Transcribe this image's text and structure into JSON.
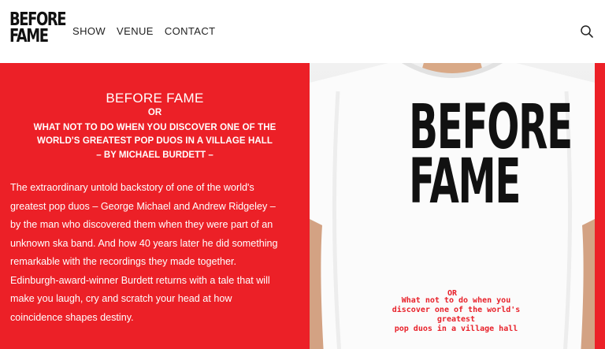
{
  "header": {
    "logo": [
      "BEFORE",
      "FAME"
    ],
    "nav": [
      "SHOW",
      "VENUE",
      "CONTACT"
    ],
    "search_icon": "search-icon"
  },
  "hero": {
    "background_color": "#ec2027",
    "title": "BEFORE FAME",
    "or": "OR",
    "subtitle_lines": [
      "WHAT NOT TO DO WHEN YOU DISCOVER ONE OF THE",
      "WORLD'S GREATEST POP DUOS IN A VILLAGE HALL"
    ],
    "author": "– BY MICHAEL BURDETT –",
    "body_lines": [
      "The extraordinary untold backstory of one of the world's",
      "greatest pop duos – George Michael and Andrew Ridgeley –",
      "by the man who discovered them when they were part of an",
      "unknown ska band. And how 40 years later he did something",
      "remarkable with the recordings they made together.",
      "Edinburgh-award-winner Burdett returns with a tale that will",
      "make you laugh, cry and scratch your head at how",
      "coincidence shapes destiny."
    ]
  },
  "tshirt": {
    "title_lines": [
      "BEFORE",
      "FAME"
    ],
    "or": "OR",
    "subtitle_lines": [
      "What not to do when you",
      "discover one of the world's greatest",
      "pop duos in a village hall"
    ]
  }
}
